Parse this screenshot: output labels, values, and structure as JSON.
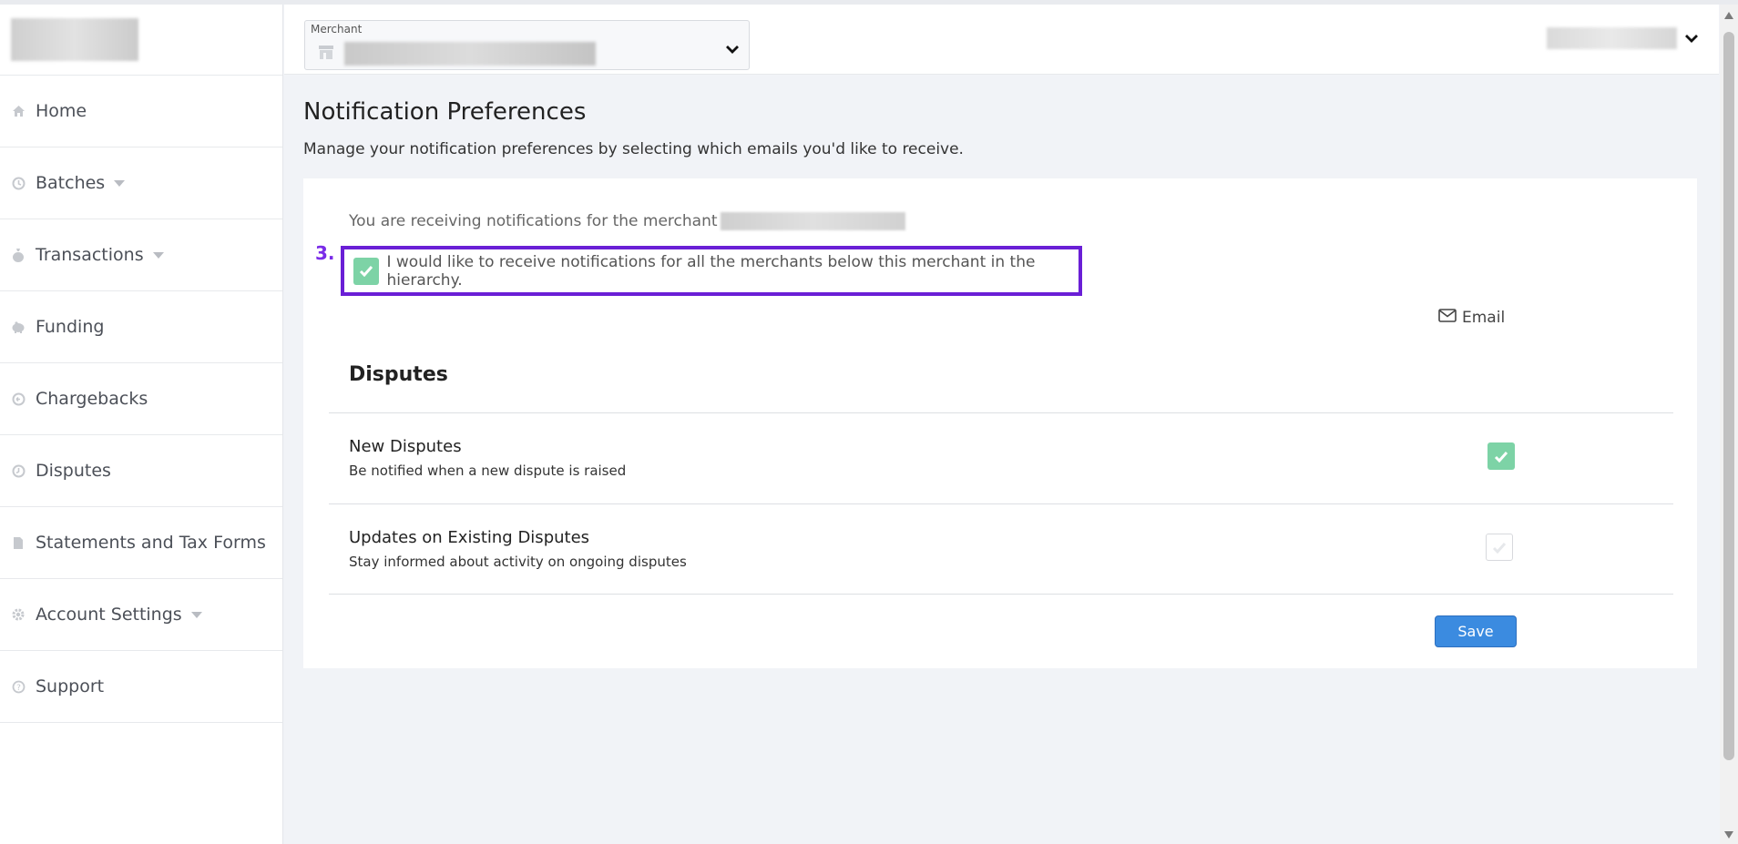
{
  "sidebar": {
    "items": [
      {
        "label": "Home",
        "icon": "home-icon"
      },
      {
        "label": "Batches",
        "icon": "batches-icon",
        "has_caret": true
      },
      {
        "label": "Transactions",
        "icon": "money-bag-icon",
        "has_caret": true
      },
      {
        "label": "Funding",
        "icon": "piggy-bank-icon"
      },
      {
        "label": "Chargebacks",
        "icon": "chargebacks-icon"
      },
      {
        "label": "Disputes",
        "icon": "disputes-icon"
      },
      {
        "label": "Statements and Tax Forms",
        "icon": "document-icon"
      },
      {
        "label": "Account Settings",
        "icon": "gear-icon",
        "has_caret": true
      },
      {
        "label": "Support",
        "icon": "help-icon"
      }
    ]
  },
  "header": {
    "merchant_label": "Merchant"
  },
  "main": {
    "title": "Notification Preferences",
    "subtitle": "Manage your notification preferences by selecting which emails you'd like to receive.",
    "receiving_text": "You are receiving notifications for the merchant",
    "step_label": "3.",
    "hierarchy_checkbox": {
      "label": "I would like to receive notifications for all the merchants below this merchant in the hierarchy.",
      "checked": true
    },
    "email_column_label": "Email",
    "section_title": "Disputes",
    "rows": [
      {
        "title": "New Disputes",
        "description": "Be notified when a new dispute is raised",
        "checked": true
      },
      {
        "title": "Updates on Existing Disputes",
        "description": "Stay informed about activity on ongoing disputes",
        "checked": false
      }
    ],
    "save_label": "Save"
  },
  "colors": {
    "accent": "#3b8be0",
    "checkbox_on": "#7dd3a6",
    "highlight": "#6a1fd6"
  }
}
